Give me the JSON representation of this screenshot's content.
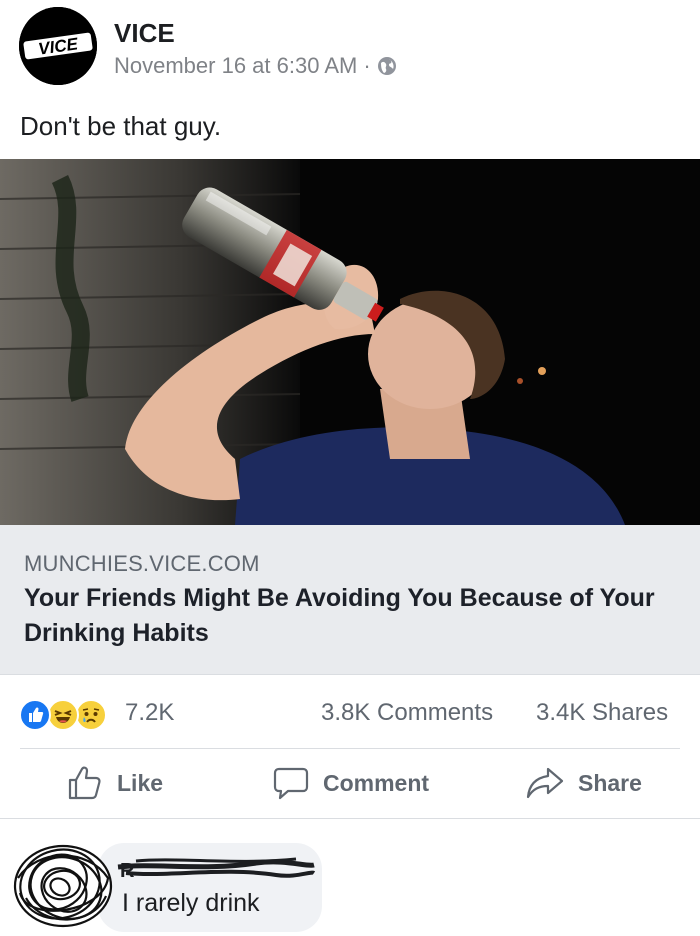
{
  "post": {
    "page_name": "VICE",
    "avatar_logo_text": "VICE",
    "timestamp": "November 16 at 6:30 AM",
    "separator": "·",
    "privacy_icon": "globe-icon",
    "caption": "Don't be that guy."
  },
  "link_preview": {
    "domain": "MUNCHIES.VICE.COM",
    "title": "Your Friends Might Be Avoiding You Because of Your Drinking Habits"
  },
  "stats": {
    "reaction_icons": [
      "like-reaction-icon",
      "haha-reaction-icon",
      "sad-reaction-icon"
    ],
    "reaction_count": "7.2K",
    "comment_count": "3.8K Comments",
    "share_count": "3.4K Shares"
  },
  "actions": {
    "like_label": "Like",
    "comment_label": "Comment",
    "share_label": "Share"
  },
  "comment": {
    "text": "I rarely drink"
  },
  "colors": {
    "like_blue": "#1877f2",
    "reaction_yellow": "#f7d03c",
    "text_secondary": "#606770",
    "link_box_bg": "#e9ebee",
    "comment_bubble_bg": "#f0f2f5"
  }
}
